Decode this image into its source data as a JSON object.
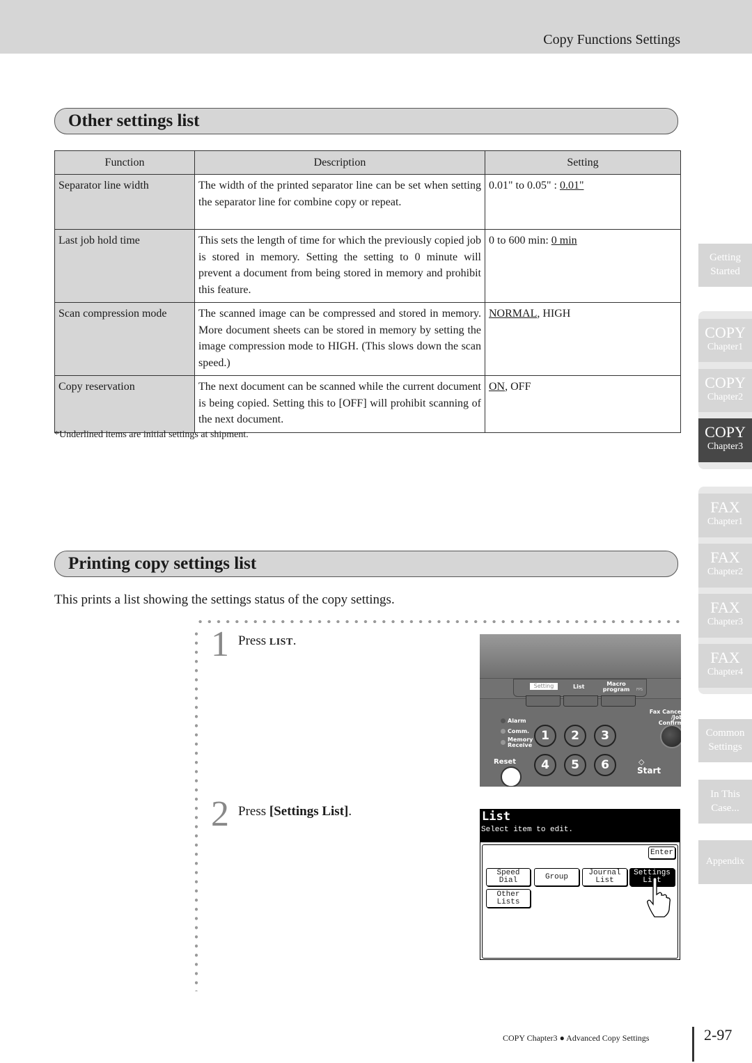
{
  "header": {
    "section_title": "Copy Functions Settings"
  },
  "other_settings": {
    "heading": "Other settings list",
    "columns": [
      "Function",
      "Description",
      "Setting"
    ],
    "rows": [
      {
        "function": "Separator line width",
        "description": "The width of the printed separator line can be set when setting the separator line for combine copy or repeat.",
        "setting_prefix": "0.01\" to 0.05\" : ",
        "setting_default": "0.01\"",
        "setting_suffix": ""
      },
      {
        "function": "Last job hold time",
        "description": "This sets the length of time for which the previously copied job is stored in memory. Setting the setting to 0 minute will prevent a document from being stored in memory and prohibit this feature.",
        "setting_prefix": "0 to 600 min: ",
        "setting_default": "0 min",
        "setting_suffix": ""
      },
      {
        "function": "Scan compression mode",
        "description": "The scanned image can be compressed and stored in memory. More document sheets can be stored in memory by setting the image compression mode to HIGH. (This slows down the scan speed.)",
        "setting_prefix": "",
        "setting_default": "NORMAL",
        "setting_suffix": ", HIGH"
      },
      {
        "function": "Copy reservation",
        "description": "The next document can be scanned while the current document is being copied. Setting this to [OFF] will prohibit scanning of the next document.",
        "setting_prefix": "",
        "setting_default": "ON",
        "setting_suffix": ", OFF"
      }
    ],
    "footnote": "*Underlined items are initial settings at shipment."
  },
  "printing": {
    "heading": "Printing copy settings list",
    "intro": "This prints a list showing the settings status of the copy settings.",
    "steps": [
      {
        "number": "1",
        "text_prefix": "Press ",
        "key": "LIST",
        "text_suffix": "."
      },
      {
        "number": "2",
        "text_prefix": "Press ",
        "key": "[Settings List]",
        "text_suffix": "."
      }
    ]
  },
  "panel": {
    "tab_labels": [
      "Setting",
      "List",
      "Macro program"
    ],
    "small_label": "FPS",
    "fax_cancel": "Fax Cancel /Job Confirm",
    "leds": [
      "Alarm",
      "Comm.",
      "Memory Receive"
    ],
    "keys": [
      "1",
      "2",
      "3",
      "4",
      "5",
      "6"
    ],
    "reset": "Reset",
    "start": "Start"
  },
  "screen": {
    "title": "List",
    "subtitle": "Select item to edit.",
    "enter": "Enter",
    "buttons": [
      "Speed Dial",
      "Group",
      "Journal List",
      "Settings List",
      "Other Lists"
    ]
  },
  "sidebar": {
    "items": [
      {
        "line1": "Getting",
        "line2": "Started"
      },
      {
        "line1": "COPY",
        "line2": "Chapter1"
      },
      {
        "line1": "COPY",
        "line2": "Chapter2"
      },
      {
        "line1": "COPY",
        "line2": "Chapter3",
        "active": true
      },
      {
        "line1": "FAX",
        "line2": "Chapter1"
      },
      {
        "line1": "FAX",
        "line2": "Chapter2"
      },
      {
        "line1": "FAX",
        "line2": "Chapter3"
      },
      {
        "line1": "FAX",
        "line2": "Chapter4"
      },
      {
        "line1": "Common",
        "line2": "Settings"
      },
      {
        "line1": "In This",
        "line2": "Case..."
      },
      {
        "line1": "Appendix",
        "line2": ""
      }
    ]
  },
  "footer": {
    "breadcrumb_left": "COPY Chapter3",
    "bullet": "●",
    "breadcrumb_right": "Advanced Copy Settings",
    "page_number": "2-97"
  }
}
